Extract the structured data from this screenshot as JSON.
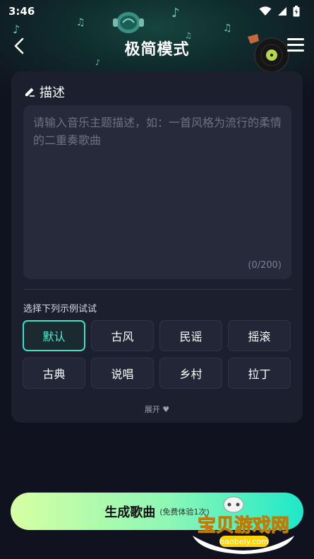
{
  "status_bar": {
    "time": "3:46"
  },
  "header": {
    "title": "极简模式"
  },
  "description": {
    "heading": "描述",
    "placeholder": "请输入音乐主题描述，如：一首风格为流行的柔情的二重奏歌曲",
    "counter": "(0/200)"
  },
  "examples": {
    "title": "选择下列示例试试",
    "chips": [
      {
        "label": "默认",
        "selected": true
      },
      {
        "label": "古风",
        "selected": false
      },
      {
        "label": "民谣",
        "selected": false
      },
      {
        "label": "摇滚",
        "selected": false
      },
      {
        "label": "古典",
        "selected": false
      },
      {
        "label": "说唱",
        "selected": false
      },
      {
        "label": "乡村",
        "selected": false
      },
      {
        "label": "拉丁",
        "selected": false
      }
    ],
    "expand_label": "展开 ♥"
  },
  "generate": {
    "label": "生成歌曲",
    "sublabel": "(免费体验1次)"
  },
  "watermark": {
    "brand": "宝贝游戏网",
    "domain": "baobeiy.com"
  },
  "colors": {
    "accent": "#3de0c8",
    "background": "#10121f",
    "card": "#1c1f2e"
  }
}
